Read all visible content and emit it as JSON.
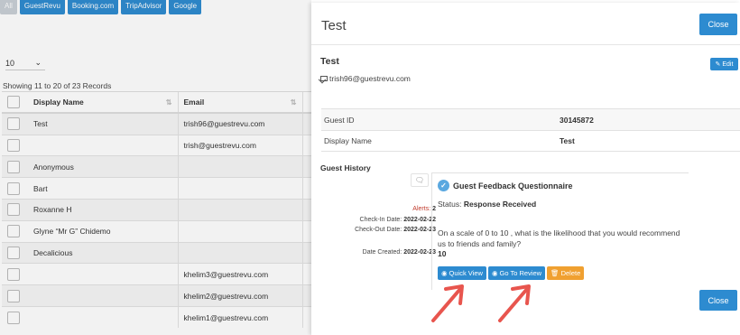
{
  "filters": [
    "All",
    "GuestRevu",
    "Booking.com",
    "TripAdvisor",
    "Google"
  ],
  "page_size": "10",
  "records_text": "Showing 11 to 20 of 23 Records",
  "table": {
    "headers": [
      "Display Name",
      "Email"
    ],
    "rows": [
      {
        "name": "Test",
        "email": "trish96@guestrevu.com"
      },
      {
        "name": "",
        "email": "trish@guestrevu.com"
      },
      {
        "name": "Anonymous",
        "email": ""
      },
      {
        "name": "Bart",
        "email": ""
      },
      {
        "name": "Roxanne H",
        "email": ""
      },
      {
        "name": "Glyne “Mr G” Chidemo",
        "email": ""
      },
      {
        "name": "Decalicious",
        "email": ""
      },
      {
        "name": "",
        "email": "khelim3@guestrevu.com"
      },
      {
        "name": "",
        "email": "khelim2@guestrevu.com"
      },
      {
        "name": "",
        "email": "khelim1@guestrevu.com"
      }
    ]
  },
  "panel": {
    "title": "Test",
    "close_label": "Close",
    "edit_label": "Edit",
    "guest_name": "Test",
    "guest_email": "trish96@guestrevu.com",
    "info": [
      {
        "key": "Guest ID",
        "value": "30145872"
      },
      {
        "key": "Display Name",
        "value": "Test"
      }
    ],
    "history_title": "Guest History",
    "history": {
      "alerts_label": "Alerts:",
      "alerts_value": "2",
      "checkin_label": "Check-In Date:",
      "checkin_value": "2022-02-22",
      "checkout_label": "Check-Out Date:",
      "checkout_value": "2022-02-23",
      "created_label": "Date Created:",
      "created_value": "2022-02-23",
      "card_title": "Guest Feedback Questionnaire",
      "status_label": "Status:",
      "status_value": "Response Received",
      "question": "On a scale of 0 to 10 , what is the likelihood that you would recommend us to friends and family?",
      "answer": "10",
      "quick_view": "Quick View",
      "go_to_review": "Go To Review",
      "delete": "Delete"
    }
  },
  "colors": {
    "accent": "#2d8bd0",
    "delete": "#f0a030",
    "alerts": "#c0392b",
    "arrow": "#e8554e"
  }
}
